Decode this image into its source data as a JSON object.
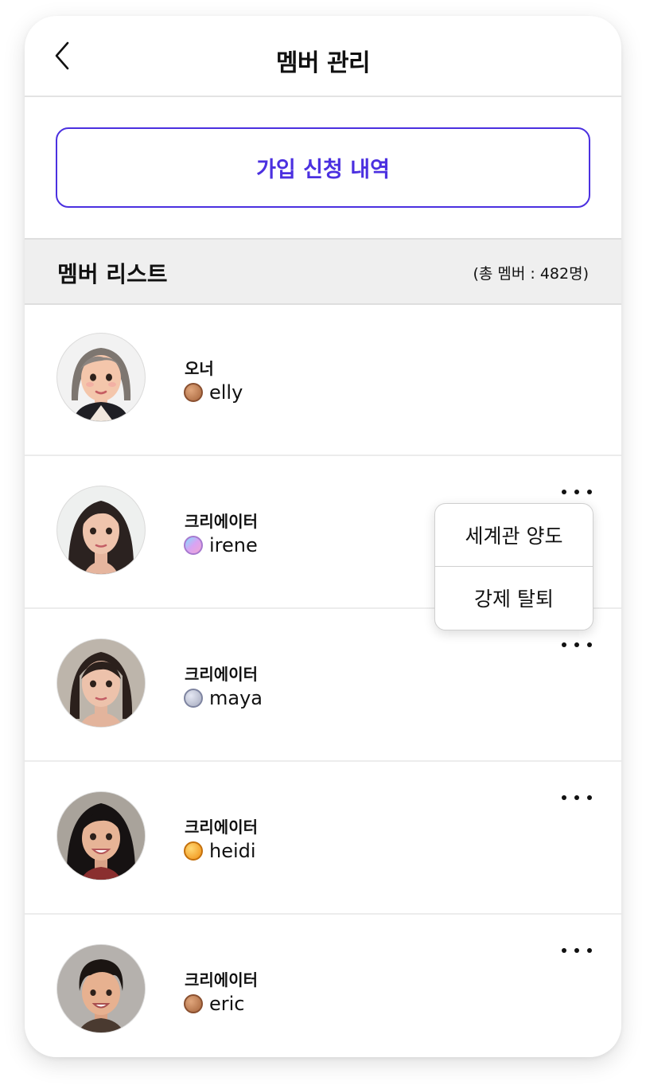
{
  "header": {
    "title": "멤버 관리"
  },
  "apply_button": {
    "label": "가입 신청 내역"
  },
  "member_list": {
    "title": "멤버 리스트",
    "count_text": "(총 멤버 : 482명)"
  },
  "members": [
    {
      "role": "오너",
      "username": "elly",
      "badge": "bronze",
      "avatar": "woman-bob-gray-hair"
    },
    {
      "role": "크리에이터",
      "username": "irene",
      "badge": "iridescent",
      "avatar": "woman-long-dark-hair"
    },
    {
      "role": "크리에이터",
      "username": "maya",
      "badge": "silver",
      "avatar": "woman-shoulder-dark-hair"
    },
    {
      "role": "크리에이터",
      "username": "heidi",
      "badge": "gold",
      "avatar": "woman-long-black-hair-smiling"
    },
    {
      "role": "크리에이터",
      "username": "eric",
      "badge": "bronze",
      "avatar": "man-short-black-hair"
    }
  ],
  "dropdown_menu": {
    "items": [
      "세계관 양도",
      "강제 탈퇴"
    ]
  },
  "icons": {
    "back": "chevron-left-icon",
    "more": "more-horizontal-icon"
  },
  "colors": {
    "accent": "#4b30e0",
    "badge_bronze": "#b87a52",
    "badge_iridescent": "#c79ae6",
    "badge_silver": "#b9bccc",
    "badge_gold": "#f3ab2e"
  }
}
